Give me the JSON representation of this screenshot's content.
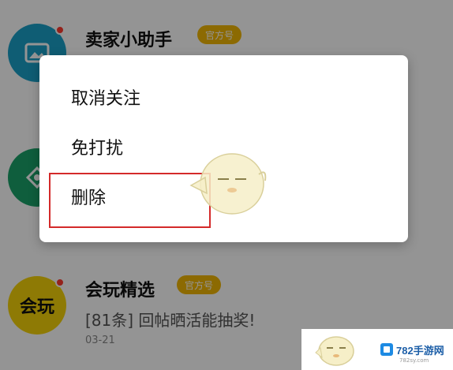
{
  "list": {
    "items": [
      {
        "title": "卖家小助手",
        "badge": "官方号",
        "has_unread_dot": true,
        "avatar_icon": "image-icon",
        "avatar_color": "#1aa0c8"
      },
      {
        "title": "",
        "avatar_icon": "tag-icon",
        "avatar_color": "#1aa369"
      },
      {
        "title": "会玩精选",
        "badge": "官方号",
        "has_unread_dot": true,
        "avatar_text": "会玩",
        "avatar_color": "#f5d20a",
        "preview": "[81条] 回帖晒活能抽奖!",
        "time": "03-21"
      }
    ]
  },
  "context_menu": {
    "items": [
      {
        "label": "取消关注"
      },
      {
        "label": "免打扰"
      },
      {
        "label": "删除",
        "highlighted": true
      }
    ],
    "highlight_color": "#d42a2a"
  },
  "watermark": {
    "site_name": "782手游网",
    "site_url": "782sy.com"
  }
}
